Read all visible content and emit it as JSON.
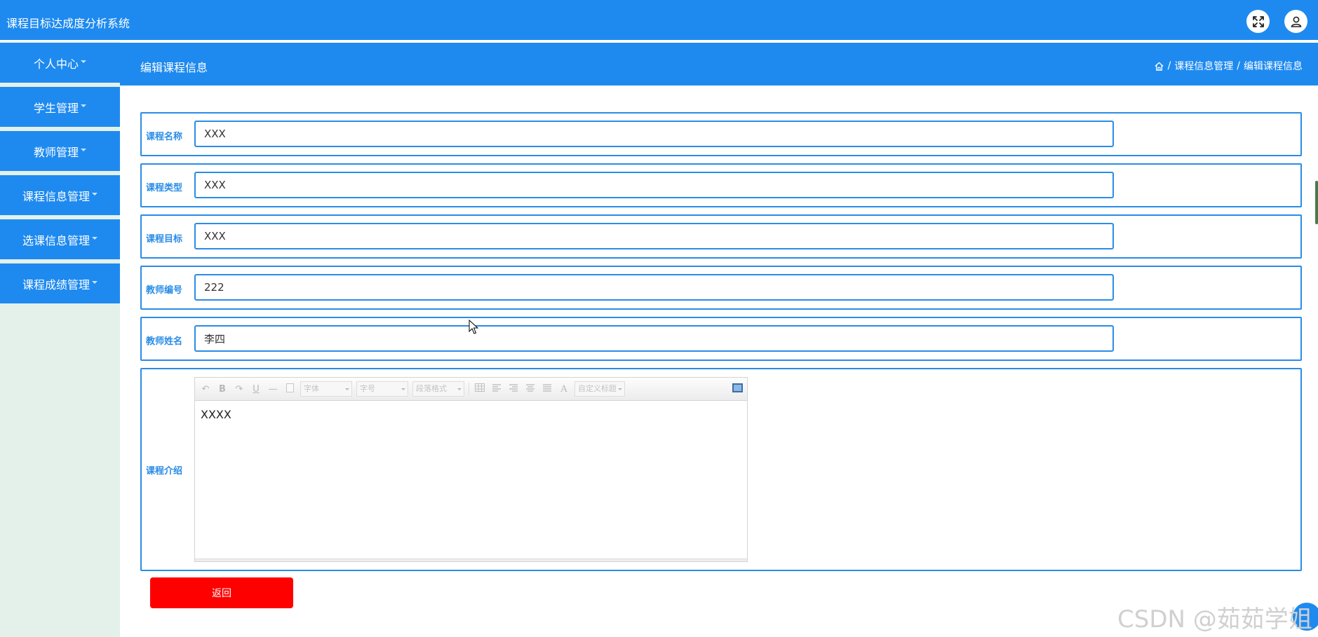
{
  "app": {
    "title": "课程目标达成度分析系统"
  },
  "topbar": {
    "fullscreen_icon": "expand-icon",
    "user_icon": "user-icon"
  },
  "sidebar": {
    "items": [
      {
        "label": "个人中心"
      },
      {
        "label": "学生管理"
      },
      {
        "label": "教师管理"
      },
      {
        "label": "课程信息管理"
      },
      {
        "label": "选课信息管理"
      },
      {
        "label": "课程成绩管理"
      }
    ]
  },
  "header": {
    "title": "编辑课程信息",
    "breadcrumb": {
      "sep1": "/",
      "level1": "课程信息管理",
      "sep2": "/",
      "level2": "编辑课程信息"
    }
  },
  "form": {
    "fields": [
      {
        "label": "课程名称",
        "value": "XXX"
      },
      {
        "label": "课程类型",
        "value": "XXX"
      },
      {
        "label": "课程目标",
        "value": "XXX"
      },
      {
        "label": "教师编号",
        "value": "222"
      },
      {
        "label": "教师姓名",
        "value": "李四"
      }
    ],
    "intro": {
      "label": "课程介绍",
      "content": "XXXX",
      "toolbar": {
        "undo": "↶",
        "bold": "B",
        "redo": "↷",
        "underline": "U",
        "hr": "—",
        "font_family": "字体",
        "font_size": "字号",
        "paragraph": "段落格式",
        "font_color": "A",
        "custom_title": "自定义标题"
      }
    },
    "back_label": "返回"
  },
  "watermark": "CSDN @茹茹学姐"
}
